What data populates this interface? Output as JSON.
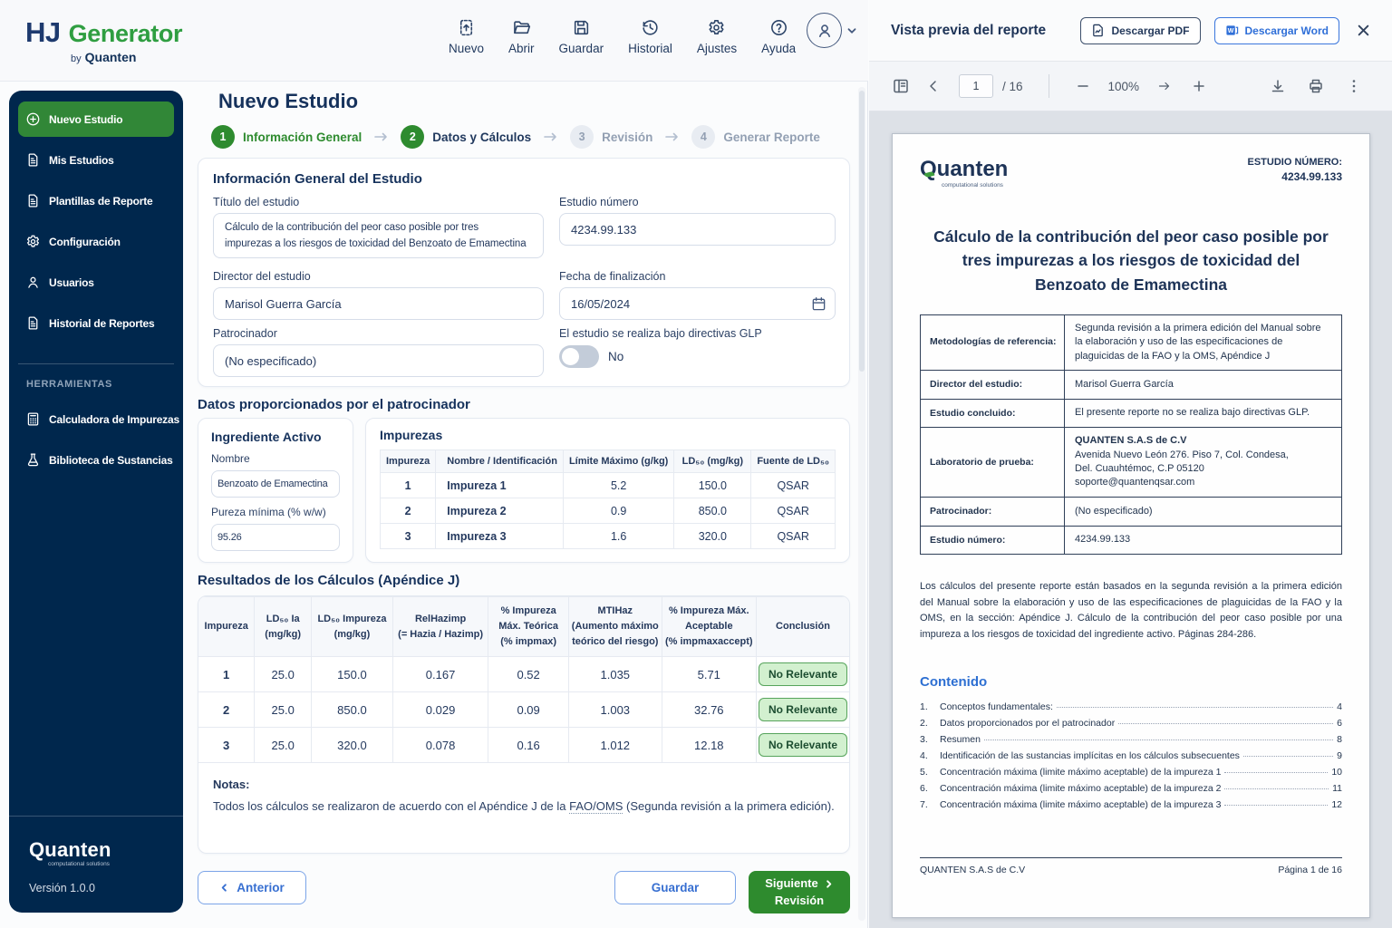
{
  "colors": {
    "sidebar_navy": "#00274D",
    "accent_green": "#2E8B2F",
    "accent_blue": "#376FD1",
    "badge_green_bg": "#DDF3D9",
    "canvas_gray": "#DDE1E7"
  },
  "header": {
    "logo": {
      "hj": "HJ",
      "generator": "Generator",
      "by": "by",
      "brand": "Quanten"
    },
    "toolbar": [
      {
        "icon": "new-file",
        "label": "Nuevo"
      },
      {
        "icon": "open-folder",
        "label": "Abrir"
      },
      {
        "icon": "save",
        "label": "Guardar"
      },
      {
        "icon": "history",
        "label": "Historial"
      },
      {
        "icon": "gear",
        "label": "Ajustes"
      },
      {
        "icon": "help",
        "label": "Ayuda"
      }
    ]
  },
  "sidebar": {
    "items": [
      {
        "icon": "plus-circle",
        "label": "Nuevo Estudio",
        "active": true
      },
      {
        "icon": "document",
        "label": "Mis Estudios",
        "active": false
      },
      {
        "icon": "document",
        "label": "Plantillas de Reporte",
        "active": false
      },
      {
        "icon": "gear",
        "label": "Configuración",
        "active": false
      },
      {
        "icon": "user",
        "label": "Usuarios",
        "active": false
      },
      {
        "icon": "document",
        "label": "Historial de Reportes",
        "active": false
      }
    ],
    "section_label": "HERRAMIENTAS",
    "tools": [
      {
        "icon": "calculator",
        "label": "Calculadora de Impurezas"
      },
      {
        "icon": "flask",
        "label": "Biblioteca de Sustancias"
      }
    ],
    "footer": {
      "brand": "Quanten",
      "tagline": "computational solutions",
      "version": "Versión 1.0.0"
    }
  },
  "main": {
    "title": "Nuevo Estudio",
    "steps": [
      {
        "num": "1",
        "label": "Información General",
        "circle": "green",
        "label_color": "green"
      },
      {
        "num": "2",
        "label": "Datos y Cálculos",
        "circle": "green",
        "label_color": "dark"
      },
      {
        "num": "3",
        "label": "Revisión",
        "circle": "gray",
        "label_color": "gray"
      },
      {
        "num": "4",
        "label": "Generar Reporte",
        "circle": "gray",
        "label_color": "gray"
      }
    ],
    "info": {
      "heading": "Información General del Estudio",
      "titulo": {
        "label": "Título del estudio",
        "value": "Cálculo de la contribución del peor caso posible por tres impurezas a los riesgos de toxicidad del Benzoato de Emamectina"
      },
      "numero": {
        "label": "Estudio número",
        "value": "4234.99.133"
      },
      "director": {
        "label": "Director del estudio",
        "value": "Marisol Guerra García"
      },
      "fecha": {
        "label": "Fecha de finalización",
        "value": "16/05/2024"
      },
      "patrocinador": {
        "label": "Patrocinador",
        "value": "(No especificado)"
      },
      "glp": {
        "label": "El estudio se realiza bajo directivas GLP",
        "value": "No",
        "enabled": false
      }
    },
    "sponsor": {
      "heading": "Datos proporcionados por el patrocinador",
      "ingredient": {
        "title": "Ingrediente Activo",
        "nombre_label": "Nombre",
        "nombre": "Benzoato de Emamectina",
        "pureza_label": "Pureza mínima (% w/w)",
        "pureza": "95.26"
      },
      "impurities": {
        "title": "Impurezas",
        "columns": [
          "Impureza",
          "Nombre / Identificación",
          "Límite Máximo (g/kg)",
          "LD₅₀ (mg/kg)",
          "Fuente de LD₅₀"
        ],
        "rows": [
          [
            "1",
            "Impureza 1",
            "5.2",
            "150.0",
            "QSAR"
          ],
          [
            "2",
            "Impureza 2",
            "0.9",
            "850.0",
            "QSAR"
          ],
          [
            "3",
            "Impureza 3",
            "1.6",
            "320.0",
            "QSAR"
          ]
        ]
      }
    },
    "results": {
      "heading": "Resultados de los Cálculos (Apéndice J)",
      "columns": [
        "Impureza",
        "LD₅₀ Ia\n(mg/kg)",
        "LD₅₀ Impureza\n(mg/kg)",
        "RelHazimp\n(= Hazia / Hazimp)",
        "% Impureza\nMáx. Teórica\n(% impmax)",
        "MTIHaz\n(Aumento máximo\nteórico del riesgo)",
        "% Impureza Máx.\nAceptable\n(% impmaxaccept)",
        "Conclusión"
      ],
      "rows": [
        [
          "1",
          "25.0",
          "150.0",
          "0.167",
          "0.52",
          "1.035",
          "5.71"
        ],
        [
          "2",
          "25.0",
          "850.0",
          "0.029",
          "0.09",
          "1.003",
          "32.76"
        ],
        [
          "3",
          "25.0",
          "320.0",
          "0.078",
          "0.16",
          "1.012",
          "12.18"
        ]
      ],
      "badge": "No Relevante",
      "notes_label": "Notas:",
      "notes_pre": "Todos los cálculos se realizaron de acuerdo con el Apéndice J de la ",
      "notes_link": "FAO/OMS",
      "notes_post": " (Segunda revisión a la primera edición)."
    },
    "actions": {
      "back": "Anterior",
      "save": "Guardar",
      "next_line1": "Siguiente",
      "next_line2": "Revisión"
    }
  },
  "preview": {
    "title": "Vista previa del reporte",
    "download_pdf": "Descargar PDF",
    "download_word": "Descargar Word",
    "toolbar": {
      "page": "1",
      "total": "/ 16",
      "zoom": "100%"
    },
    "doc": {
      "brand": "Quanten",
      "brand_tagline": "computational solutions",
      "study_no_label": "ESTUDIO NÚMERO:",
      "study_no": "4234.99.133",
      "title": "Cálculo de la contribución del peor caso posible por tres impurezas a los riesgos de toxicidad del Benzoato de Emamectina",
      "info_rows": [
        {
          "label": "Metodologías de referencia:",
          "value": "Segunda revisión a la primera edición del Manual sobre la elaboración y uso de las especificaciones de plaguicidas de la FAO y la OMS, Apéndice J",
          "bold_first": false
        },
        {
          "label": "Director del estudio:",
          "value": "Marisol Guerra García",
          "bold_first": false
        },
        {
          "label": "Estudio concluido:",
          "value": "El presente reporte no se realiza bajo directivas GLP.",
          "bold_first": false
        },
        {
          "label": "Laboratorio de prueba:",
          "value": "QUANTEN S.A.S de C.V\nAvenida Nuevo León 276. Piso 7, Col. Condesa,\nDel. Cuauhtémoc, C.P 05120\nsoporte@quantenqsar.com",
          "bold_first": true
        },
        {
          "label": "Patrocinador:",
          "value": "(No especificado)",
          "bold_first": false
        },
        {
          "label": "Estudio número:",
          "value": "4234.99.133",
          "bold_first": false
        }
      ],
      "paragraph": "Los cálculos del presente reporte están basados en la segunda revisión a la primera edición del Manual sobre la elaboración y uso de las especificaciones de plaguicidas de la FAO y la OMS, en la sección: Apéndice J. Cálculo de la contribución del peor caso posible por una impureza a los riesgos de toxicidad del ingrediente activo. Páginas 284-286.",
      "toc_title": "Contenido",
      "toc": [
        {
          "n": "1.",
          "label": "Conceptos fundamentales:",
          "page": "4"
        },
        {
          "n": "2.",
          "label": "Datos proporcionados por el patrocinador",
          "page": "6"
        },
        {
          "n": "3.",
          "label": "Resumen",
          "page": "8"
        },
        {
          "n": "4.",
          "label": "Identificación de las sustancias implícitas en los cálculos subsecuentes",
          "page": "9"
        },
        {
          "n": "5.",
          "label": "Concentración máxima (limite máximo aceptable) de la impureza 1",
          "page": "10"
        },
        {
          "n": "6.",
          "label": "Concentración máxima (limite máximo aceptable) de la impureza 2",
          "page": "11"
        },
        {
          "n": "7.",
          "label": "Concentración máxima (limite máximo aceptable) de la impureza 3",
          "page": "12"
        }
      ],
      "footer_left": "QUANTEN S.A.S de C.V",
      "footer_right": "Página 1 de 16"
    }
  }
}
